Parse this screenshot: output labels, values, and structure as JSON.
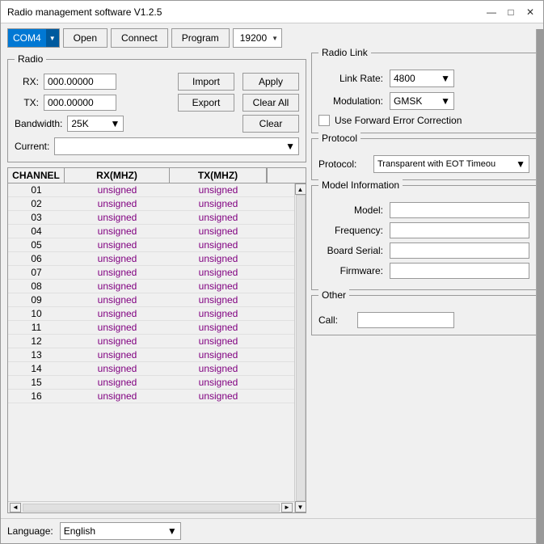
{
  "window": {
    "title": "Radio management software V1.2.5"
  },
  "titlebar": {
    "minimize_label": "—",
    "maximize_label": "□",
    "close_label": "✕"
  },
  "toolbar": {
    "com_port": "COM4",
    "open_label": "Open",
    "connect_label": "Connect",
    "program_label": "Program",
    "baud_rate": "19200"
  },
  "radio_group": {
    "title": "Radio",
    "rx_label": "RX:",
    "rx_value": "000.00000",
    "tx_label": "TX:",
    "tx_value": "000.00000",
    "import_label": "Import",
    "export_label": "Export",
    "apply_label": "Apply",
    "clear_all_label": "Clear All",
    "clear_label": "Clear",
    "bandwidth_label": "Bandwidth:",
    "bandwidth_value": "25K",
    "current_label": "Current:"
  },
  "channel_table": {
    "col_channel": "CHANNEL",
    "col_rx": "RX(MHZ)",
    "col_tx": "TX(MHZ)",
    "rows": [
      {
        "channel": "01",
        "rx": "unsigned",
        "tx": "unsigned"
      },
      {
        "channel": "02",
        "rx": "unsigned",
        "tx": "unsigned"
      },
      {
        "channel": "03",
        "rx": "unsigned",
        "tx": "unsigned"
      },
      {
        "channel": "04",
        "rx": "unsigned",
        "tx": "unsigned"
      },
      {
        "channel": "05",
        "rx": "unsigned",
        "tx": "unsigned"
      },
      {
        "channel": "06",
        "rx": "unsigned",
        "tx": "unsigned"
      },
      {
        "channel": "07",
        "rx": "unsigned",
        "tx": "unsigned"
      },
      {
        "channel": "08",
        "rx": "unsigned",
        "tx": "unsigned"
      },
      {
        "channel": "09",
        "rx": "unsigned",
        "tx": "unsigned"
      },
      {
        "channel": "10",
        "rx": "unsigned",
        "tx": "unsigned"
      },
      {
        "channel": "11",
        "rx": "unsigned",
        "tx": "unsigned"
      },
      {
        "channel": "12",
        "rx": "unsigned",
        "tx": "unsigned"
      },
      {
        "channel": "13",
        "rx": "unsigned",
        "tx": "unsigned"
      },
      {
        "channel": "14",
        "rx": "unsigned",
        "tx": "unsigned"
      },
      {
        "channel": "15",
        "rx": "unsigned",
        "tx": "unsigned"
      },
      {
        "channel": "16",
        "rx": "unsigned",
        "tx": "unsigned"
      }
    ]
  },
  "radio_link": {
    "title": "Radio Link",
    "link_rate_label": "Link Rate:",
    "link_rate_value": "4800",
    "modulation_label": "Modulation:",
    "modulation_value": "GMSK",
    "fec_label": "Use Forward Error Correction"
  },
  "protocol": {
    "title": "Protocol",
    "label": "Protocol:",
    "value": "Transparent with EOT Timeou"
  },
  "model_info": {
    "title": "Model Information",
    "model_label": "Model:",
    "frequency_label": "Frequency:",
    "board_serial_label": "Board Serial:",
    "firmware_label": "Firmware:"
  },
  "other": {
    "title": "Other",
    "call_label": "Call:"
  },
  "bottom": {
    "language_label": "Language:",
    "language_value": "English"
  }
}
